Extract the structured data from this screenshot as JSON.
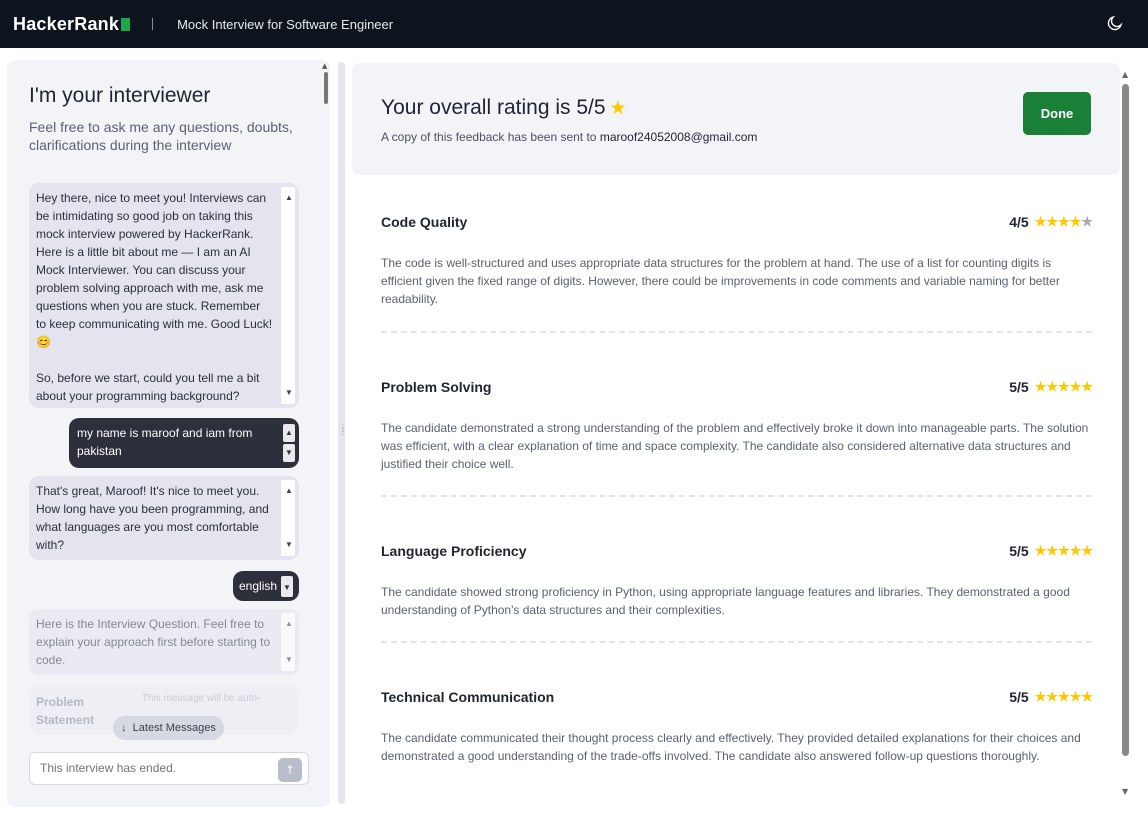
{
  "header": {
    "brand": "HackerRank",
    "title": "Mock Interview for Software Engineer",
    "theme_icon": "moon-icon"
  },
  "interviewer": {
    "title": "I'm your interviewer",
    "subtitle": "Feel free to ask me any questions, doubts, clarifications during the interview"
  },
  "chat": {
    "messages": [
      {
        "role": "ai",
        "text": "Hey there, nice to meet you! Interviews can be intimidating so good job on taking this mock interview powered by HackerRank. Here is a little bit about me — I am an AI Mock Interviewer. You can discuss your problem solving approach with me, ask me questions when you are stuck. Remember to keep communicating with me. Good Luck! 😊\n\nSo, before we start, could you tell me a bit about your programming background?"
      },
      {
        "role": "user",
        "text": "my name is maroof and iam from pakistan"
      },
      {
        "role": "ai",
        "text": "That's great, Maroof! It's nice to meet you. How long have you been programming, and what languages are you most comfortable with?"
      },
      {
        "role": "user",
        "text": "english"
      },
      {
        "role": "ai",
        "text": "Here is the Interview Question. Feel free to explain your approach first before starting to code."
      }
    ],
    "problem_title": "Problem Statement",
    "problem_note": "This message will be auto-",
    "latest_label": "Latest Messages",
    "input_placeholder": "This interview has ended."
  },
  "rating": {
    "title": "Your overall rating is 5/5",
    "sent_prefix": "A copy of this feedback has been sent to",
    "email": "maroof24052008@gmail.com",
    "done_label": "Done"
  },
  "feedback": [
    {
      "title": "Code Quality",
      "score_text": "4/5",
      "score": 4,
      "max": 5,
      "body": "The code is well-structured and uses appropriate data structures for the problem at hand. The use of a list for counting digits is efficient given the fixed range of digits. However, there could be improvements in code comments and variable naming for better readability."
    },
    {
      "title": "Problem Solving",
      "score_text": "5/5",
      "score": 5,
      "max": 5,
      "body": "The candidate demonstrated a strong understanding of the problem and effectively broke it down into manageable parts. The solution was efficient, with a clear explanation of time and space complexity. The candidate also considered alternative data structures and justified their choice well."
    },
    {
      "title": "Language Proficiency",
      "score_text": "5/5",
      "score": 5,
      "max": 5,
      "body": "The candidate showed strong proficiency in Python, using appropriate language features and libraries. They demonstrated a good understanding of Python's data structures and their complexities."
    },
    {
      "title": "Technical Communication",
      "score_text": "5/5",
      "score": 5,
      "max": 5,
      "body": "The candidate communicated their thought process clearly and effectively. They provided detailed explanations for their choices and demonstrated a good understanding of the trade-offs involved. The candidate also answered follow-up questions thoroughly."
    }
  ],
  "colors": {
    "accent_green": "#1a7f37",
    "star": "#ffc700",
    "topbar": "#0e141e"
  }
}
